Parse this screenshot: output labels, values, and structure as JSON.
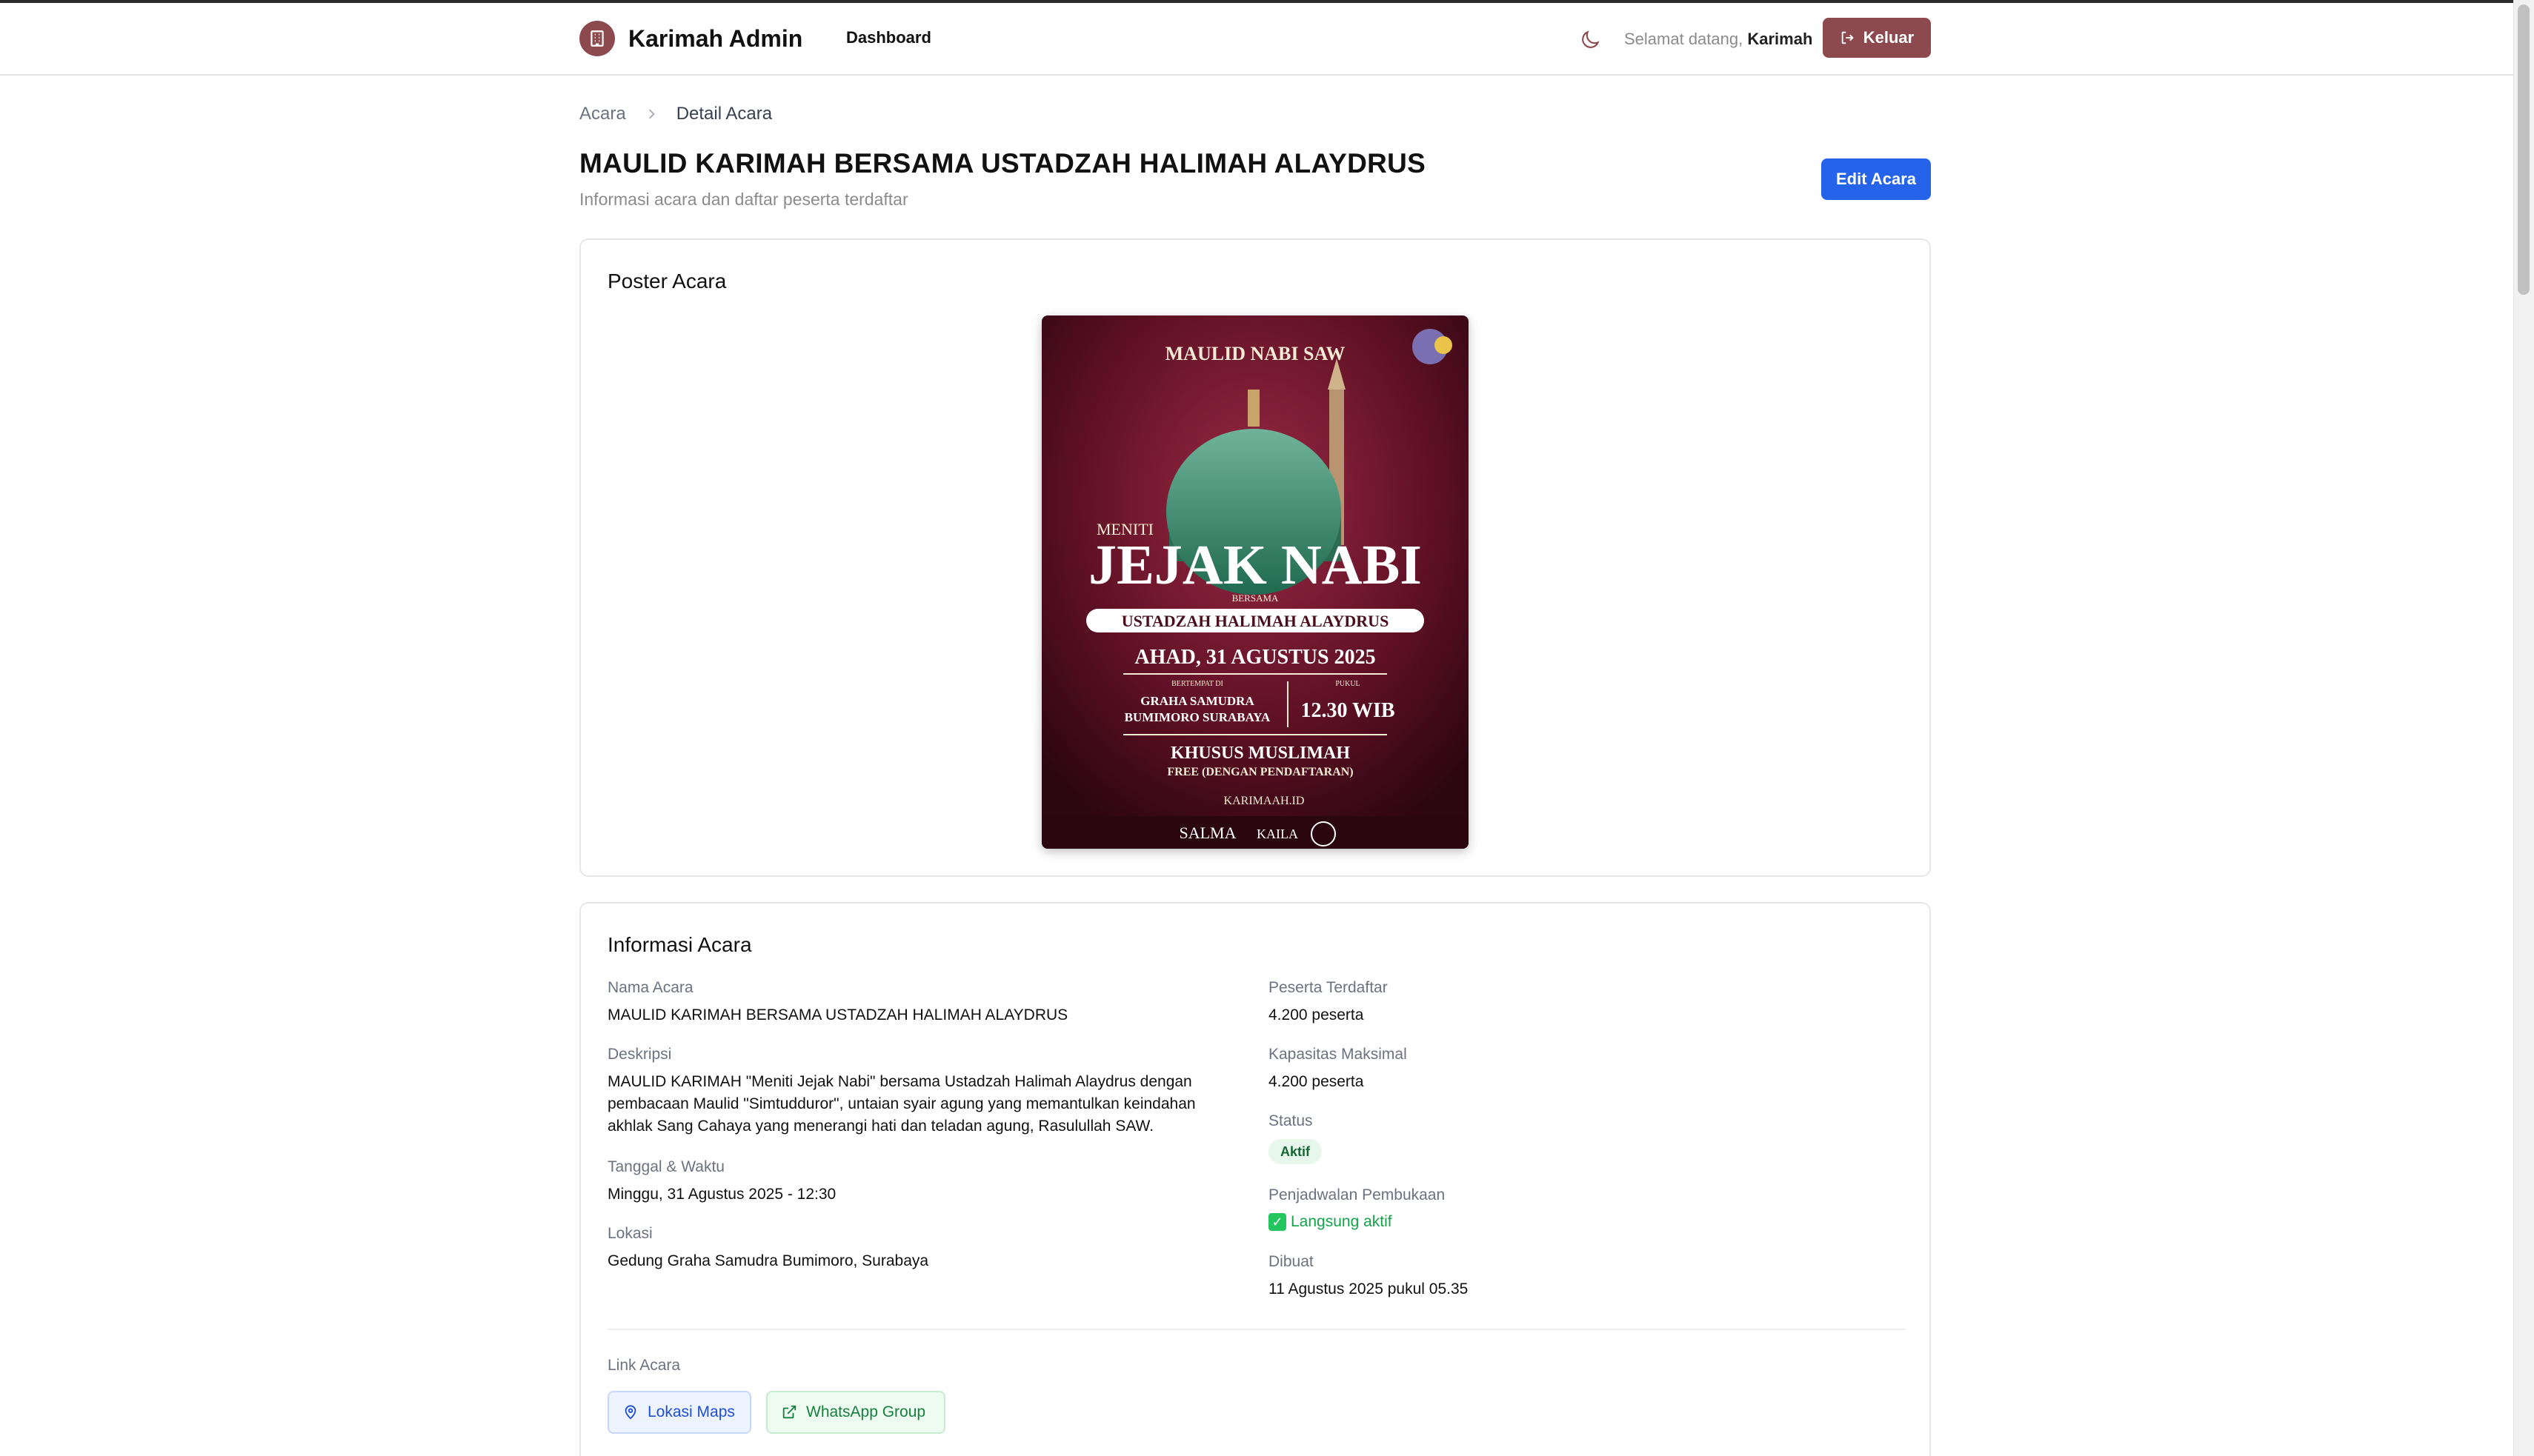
{
  "header": {
    "brand_title": "Karimah Admin",
    "nav_dashboard": "Dashboard",
    "welcome_prefix": "Selamat datang, ",
    "welcome_name": "Karimah",
    "logout_label": "Keluar"
  },
  "breadcrumb": {
    "parent": "Acara",
    "current": "Detail Acara"
  },
  "page": {
    "title": "MAULID KARIMAH BERSAMA USTADZAH HALIMAH ALAYDRUS",
    "subtitle": "Informasi acara dan daftar peserta terdaftar",
    "edit_label": "Edit Acara"
  },
  "poster_card": {
    "title": "Poster Acara",
    "poster": {
      "top": "MAULID NABI SAW",
      "meniti": "MENITI",
      "headline": "JEJAK NABI",
      "bersama": "BERSAMA",
      "speaker": "USTADZAH HALIMAH ALAYDRUS",
      "date": "AHAD, 31 AGUSTUS 2025",
      "venue_label": "BERTEMPAT DI",
      "venue_line1": "GRAHA SAMUDRA",
      "venue_line2": "BUMIMORO SURABAYA",
      "time_label": "PUKUL",
      "time": "12.30 WIB",
      "audience": "KHUSUS MUSLIMAH",
      "free": "FREE (DENGAN PENDAFTARAN)",
      "instagram": "KARIMAAH.ID",
      "sponsor1": "SALMA",
      "sponsor2": "KAILA"
    }
  },
  "info_card": {
    "title": "Informasi Acara",
    "name_label": "Nama Acara",
    "name_value": "MAULID KARIMAH BERSAMA USTADZAH HALIMAH ALAYDRUS",
    "desc_label": "Deskripsi",
    "desc_value": "MAULID KARIMAH \"Meniti Jejak Nabi\" bersama Ustadzah Halimah Alaydrus dengan pembacaan Maulid \"Simtudduror\", untaian syair agung yang memantulkan keindahan akhlak Sang Cahaya yang menerangi hati dan teladan agung, Rasulullah SAW.",
    "datetime_label": "Tanggal & Waktu",
    "datetime_value": "Minggu, 31 Agustus 2025 - 12:30",
    "location_label": "Lokasi",
    "location_value": "Gedung Graha Samudra Bumimoro, Surabaya",
    "registered_label": "Peserta Terdaftar",
    "registered_value": "4.200 peserta",
    "capacity_label": "Kapasitas Maksimal",
    "capacity_value": "4.200 peserta",
    "status_label": "Status",
    "status_value": "Aktif",
    "schedule_label": "Penjadwalan Pembukaan",
    "schedule_value": "Langsung aktif",
    "created_label": "Dibuat",
    "created_value": "11 Agustus 2025 pukul 05.35",
    "links_label": "Link Acara",
    "link_maps": "Lokasi Maps",
    "link_wa": "WhatsApp Group"
  },
  "colors": {
    "brand": "#8d4a4e",
    "primary": "#2563eb",
    "success": "#16a34a"
  }
}
